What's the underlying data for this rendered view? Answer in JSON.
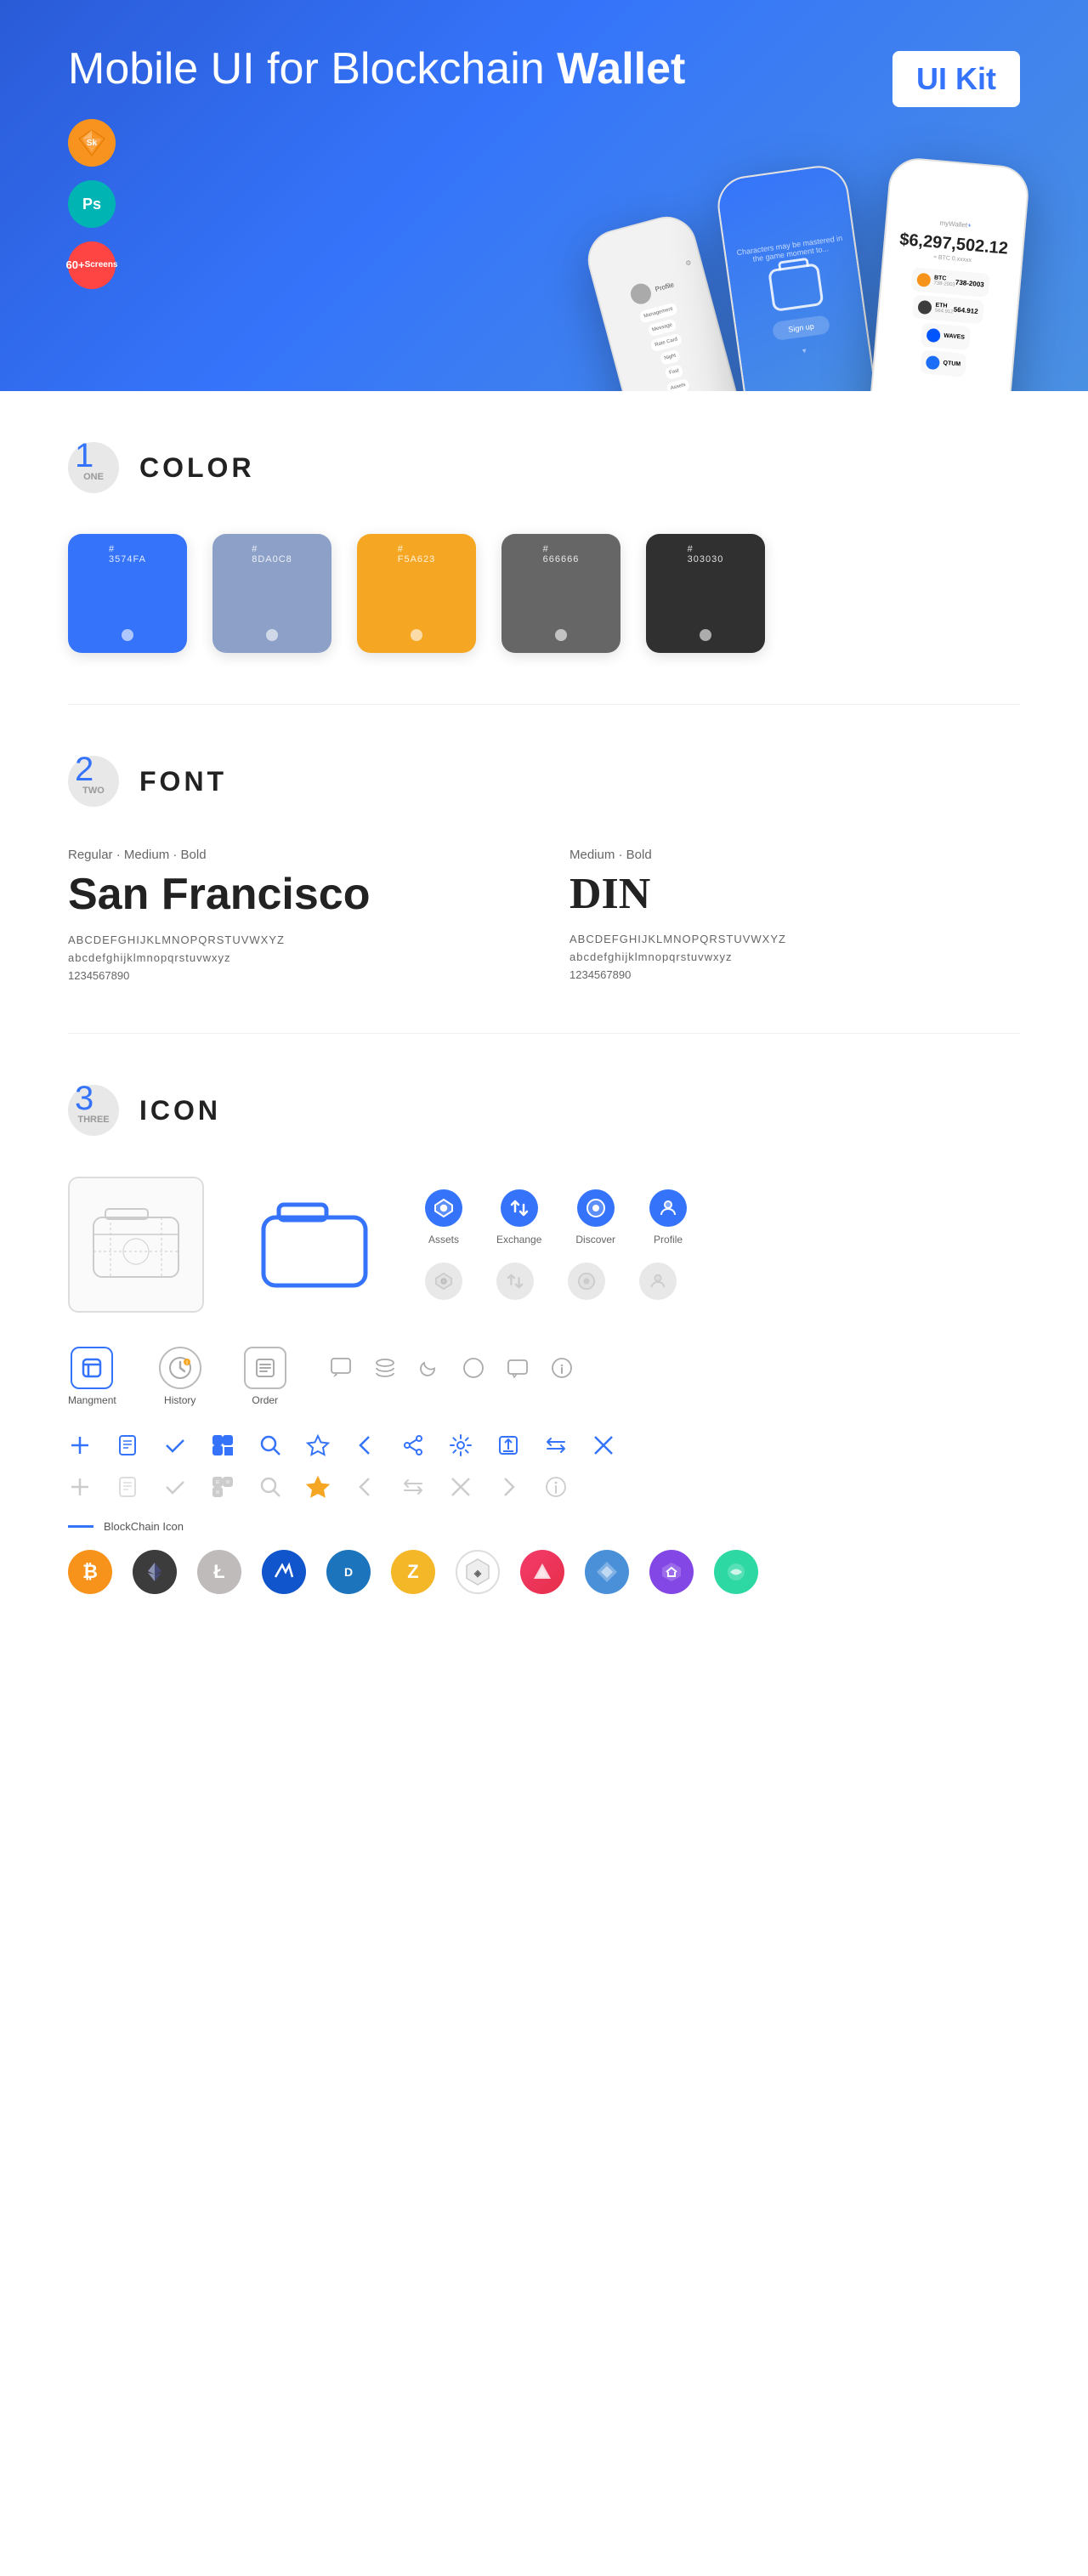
{
  "hero": {
    "title_normal": "Mobile UI for Blockchain ",
    "title_bold": "Wallet",
    "badge": "UI Kit",
    "badges": [
      {
        "label": "Sk",
        "type": "sketch"
      },
      {
        "label": "Ps",
        "type": "ps"
      },
      {
        "label": "60+\nScreens",
        "type": "count"
      }
    ]
  },
  "sections": {
    "color": {
      "number": "1",
      "number_label": "ONE",
      "title": "COLOR",
      "swatches": [
        {
          "hex": "#3574FA",
          "label": "#\n3574FA"
        },
        {
          "hex": "#8DA0C8",
          "label": "#\n8DA0C8"
        },
        {
          "hex": "#F5A623",
          "label": "#\nF5A623"
        },
        {
          "hex": "#666666",
          "label": "#\n666666"
        },
        {
          "hex": "#303030",
          "label": "#\n303030"
        }
      ]
    },
    "font": {
      "number": "2",
      "number_label": "TWO",
      "title": "FONT",
      "fonts": [
        {
          "style_label": "Regular · Medium · Bold",
          "name": "San Francisco",
          "uppercase": "ABCDEFGHIJKLMNOPQRSTUVWXYZ",
          "lowercase": "abcdefghijklmnopqrstuvwxyz",
          "numbers": "1234567890"
        },
        {
          "style_label": "Medium · Bold",
          "name": "DIN",
          "uppercase": "ABCDEFGHIJKLMNOPQRSTUVWXYZ",
          "lowercase": "abcdefghijklmnopqrstuvwxyz",
          "numbers": "1234567890"
        }
      ]
    },
    "icon": {
      "number": "3",
      "number_label": "THREE",
      "title": "ICON",
      "nav_icons": [
        {
          "label": "Assets",
          "type": "circle-blue"
        },
        {
          "label": "Exchange",
          "type": "circle-blue"
        },
        {
          "label": "Discover",
          "type": "circle-blue"
        },
        {
          "label": "Profile",
          "type": "circle-blue"
        }
      ],
      "tab_icons": [
        {
          "label": "Mangment",
          "type": "tab"
        },
        {
          "label": "History",
          "type": "clock"
        },
        {
          "label": "Order",
          "type": "list"
        }
      ],
      "blockchain_label": "BlockChain Icon",
      "crypto_icons": [
        {
          "symbol": "₿",
          "label": "BTC",
          "class": "crypto-btc"
        },
        {
          "symbol": "Ξ",
          "label": "ETH",
          "class": "crypto-eth"
        },
        {
          "symbol": "Ł",
          "label": "LTC",
          "class": "crypto-ltc"
        },
        {
          "symbol": "W",
          "label": "WAVES",
          "class": "crypto-waves"
        },
        {
          "symbol": "D",
          "label": "DASH",
          "class": "crypto-dash"
        },
        {
          "symbol": "Z",
          "label": "ZEC",
          "class": "crypto-zcash"
        },
        {
          "symbol": "◈",
          "label": "IOTA",
          "class": "crypto-iota"
        },
        {
          "symbol": "▲",
          "label": "ARK",
          "class": "crypto-ark"
        },
        {
          "symbol": "◆",
          "label": "NANO",
          "class": "crypto-nano"
        },
        {
          "symbol": "⬡",
          "label": "MATIC",
          "class": "crypto-matic"
        },
        {
          "symbol": "✦",
          "label": "DCR",
          "class": "crypto-decred"
        }
      ]
    }
  }
}
